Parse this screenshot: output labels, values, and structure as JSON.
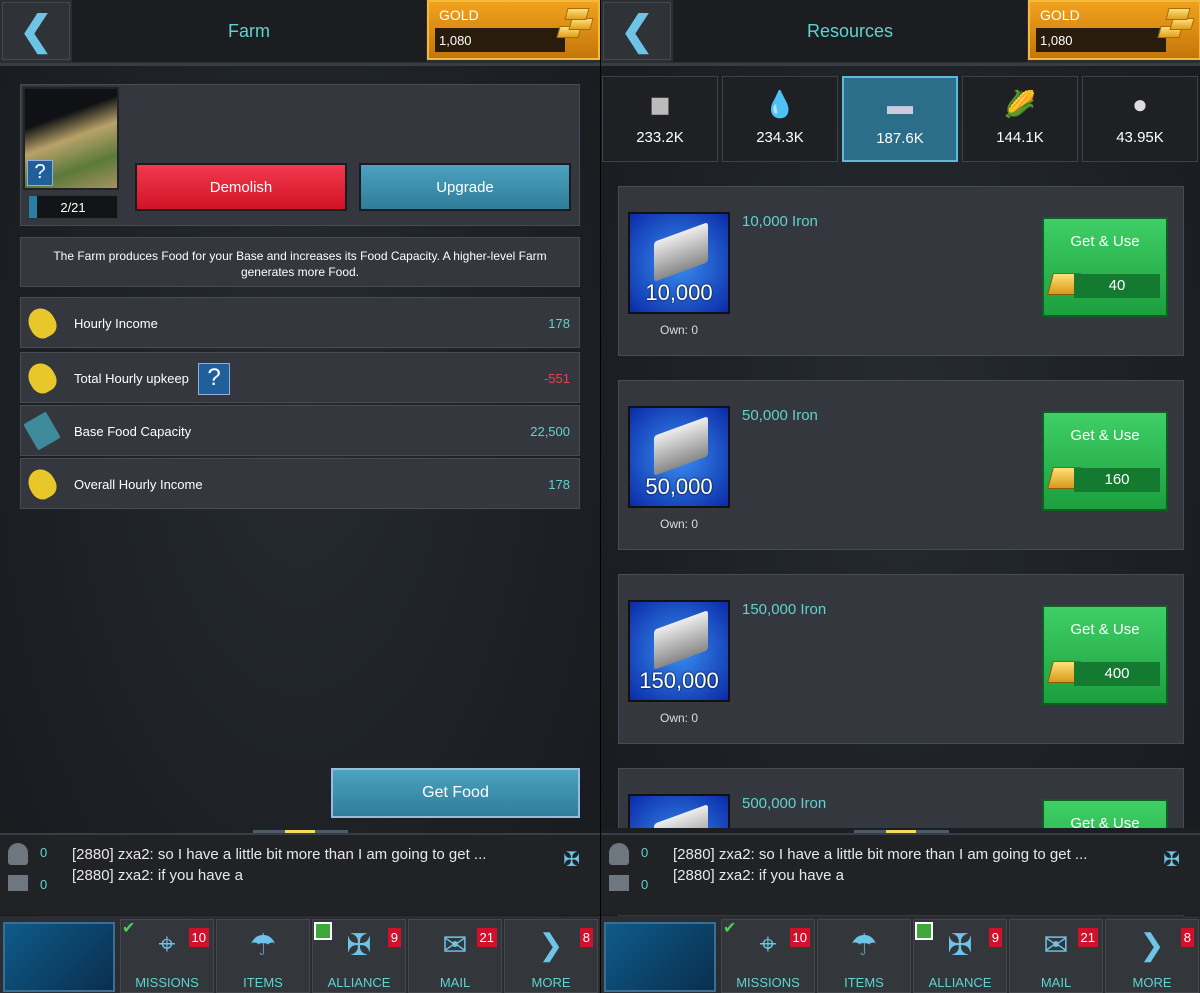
{
  "left": {
    "back_icon": "chevron-left-icon",
    "title": "Farm",
    "gold": {
      "label": "GOLD",
      "value": "1,080"
    },
    "building": {
      "level": "2/21",
      "level_fraction": 0.095,
      "demolish": "Demolish",
      "upgrade": "Upgrade",
      "help": "?"
    },
    "description": "The Farm produces Food for your Base and increases its Food Capacity. A higher-level Farm generates more Food.",
    "stats": [
      {
        "icon": "corn-icon",
        "label": "Hourly Income",
        "value": "178",
        "color": "#5fd3cf"
      },
      {
        "icon": "corn-upkeep-icon",
        "label": "Total Hourly upkeep",
        "value": "-551",
        "color": "#e8434f",
        "help": "?"
      },
      {
        "icon": "warehouse-icon",
        "label": "Base Food Capacity",
        "value": "22,500",
        "color": "#5fd3cf"
      },
      {
        "icon": "corn-overall-icon",
        "label": "Overall Hourly Income",
        "value": "178",
        "color": "#5fd3cf"
      }
    ],
    "get_food": "Get Food"
  },
  "right": {
    "title": "Resources",
    "gold": {
      "label": "GOLD",
      "value": "1,080"
    },
    "tabs": [
      {
        "icon": "stone-icon",
        "value": "233.2K"
      },
      {
        "icon": "oil-icon",
        "value": "234.3K"
      },
      {
        "icon": "iron-icon",
        "value": "187.6K",
        "selected": true
      },
      {
        "icon": "food-icon",
        "value": "144.1K"
      },
      {
        "icon": "silver-icon",
        "value": "43.95K"
      }
    ],
    "items": [
      {
        "title": "10,000 Iron",
        "badge": "10,000",
        "own": "Own:  0",
        "button": "Get & Use",
        "cost": "40"
      },
      {
        "title": "50,000 Iron",
        "badge": "50,000",
        "own": "Own:  0",
        "button": "Get & Use",
        "cost": "160"
      },
      {
        "title": "150,000 Iron",
        "badge": "150,000",
        "own": "Own:  0",
        "button": "Get & Use",
        "cost": "400"
      },
      {
        "title": "500,000 Iron",
        "badge": "",
        "own": "",
        "button": "Get & Use",
        "cost": ""
      }
    ]
  },
  "chat": {
    "members_count": "0",
    "messages_count": "0",
    "lines": [
      "[2880] zxa2: so I have a little bit more than I am going to get ...",
      "[2880] zxa2: if you have a"
    ]
  },
  "nav": [
    {
      "label": "MISSIONS",
      "badge": "10",
      "icon": "crosshair-icon"
    },
    {
      "label": "ITEMS",
      "badge": "",
      "icon": "parachute-icon"
    },
    {
      "label": "ALLIANCE",
      "badge": "9",
      "icon": "eagle-icon"
    },
    {
      "label": "MAIL",
      "badge": "21",
      "icon": "mail-icon"
    },
    {
      "label": "MORE",
      "badge": "8",
      "icon": "chevron-right-icon"
    }
  ]
}
